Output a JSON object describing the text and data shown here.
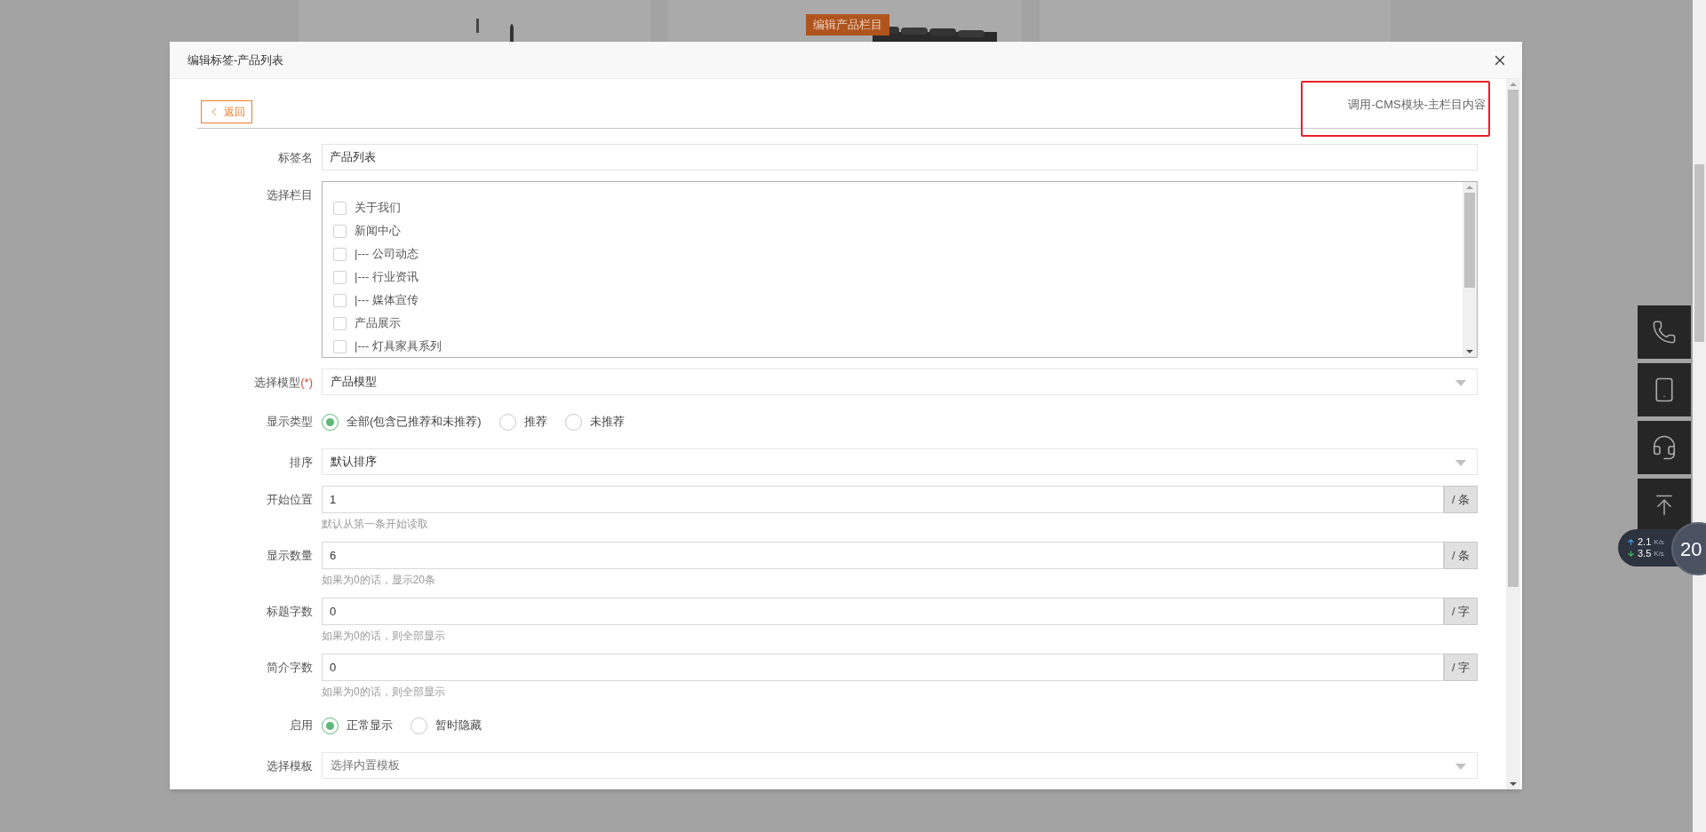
{
  "background_page": {
    "badge": "编辑产品栏目"
  },
  "dialog": {
    "title": "编辑标签-产品列表"
  },
  "toolbar": {
    "back_button": "返回",
    "breadcrumb": "调用-CMS模块-主栏目内容",
    "highlighted": true
  },
  "fields": [
    {
      "kind": "text",
      "label": "标签名",
      "value": "产品列表"
    },
    {
      "kind": "checklist",
      "label": "选择栏目",
      "items": [
        {
          "label": "关于我们",
          "checked": false
        },
        {
          "label": "新闻中心",
          "checked": false
        },
        {
          "label": "|--- 公司动态",
          "checked": false
        },
        {
          "label": "|--- 行业资讯",
          "checked": false
        },
        {
          "label": "|--- 媒体宣传",
          "checked": false
        },
        {
          "label": "产品展示",
          "checked": false
        },
        {
          "label": "|--- 灯具家具系列",
          "checked": false
        }
      ]
    },
    {
      "kind": "select",
      "label": "选择模型",
      "required_mark": "(*)",
      "value": "产品模型"
    },
    {
      "kind": "radio",
      "label": "显示类型",
      "options": [
        {
          "label": "全部(包含已推荐和未推荐)",
          "selected": true
        },
        {
          "label": "推荐",
          "selected": false
        },
        {
          "label": "未推荐",
          "selected": false
        }
      ]
    },
    {
      "kind": "select",
      "label": "排序",
      "value": "默认排序"
    },
    {
      "kind": "suffix",
      "label": "开始位置",
      "value": "1",
      "suffix": "/ 条",
      "hint": "默认从第一条开始读取"
    },
    {
      "kind": "suffix",
      "label": "显示数量",
      "value": "6",
      "suffix": "/ 条",
      "hint": "如果为0的话，显示20条"
    },
    {
      "kind": "suffix",
      "label": "标题字数",
      "value": "0",
      "suffix": "/ 字",
      "hint": "如果为0的话，则全部显示"
    },
    {
      "kind": "suffix",
      "label": "简介字数",
      "value": "0",
      "suffix": "/ 字",
      "hint": "如果为0的话，则全部显示"
    },
    {
      "kind": "radio",
      "label": "启用",
      "options": [
        {
          "label": "正常显示",
          "selected": true
        },
        {
          "label": "暂时隐藏",
          "selected": false
        }
      ]
    },
    {
      "kind": "select",
      "label": "选择模板",
      "placeholder": "选择内置模板"
    }
  ],
  "speed_widget": {
    "upload": "2.1",
    "upload_unit": "K/s",
    "download": "3.5",
    "download_unit": "K/s",
    "badge": "20"
  }
}
